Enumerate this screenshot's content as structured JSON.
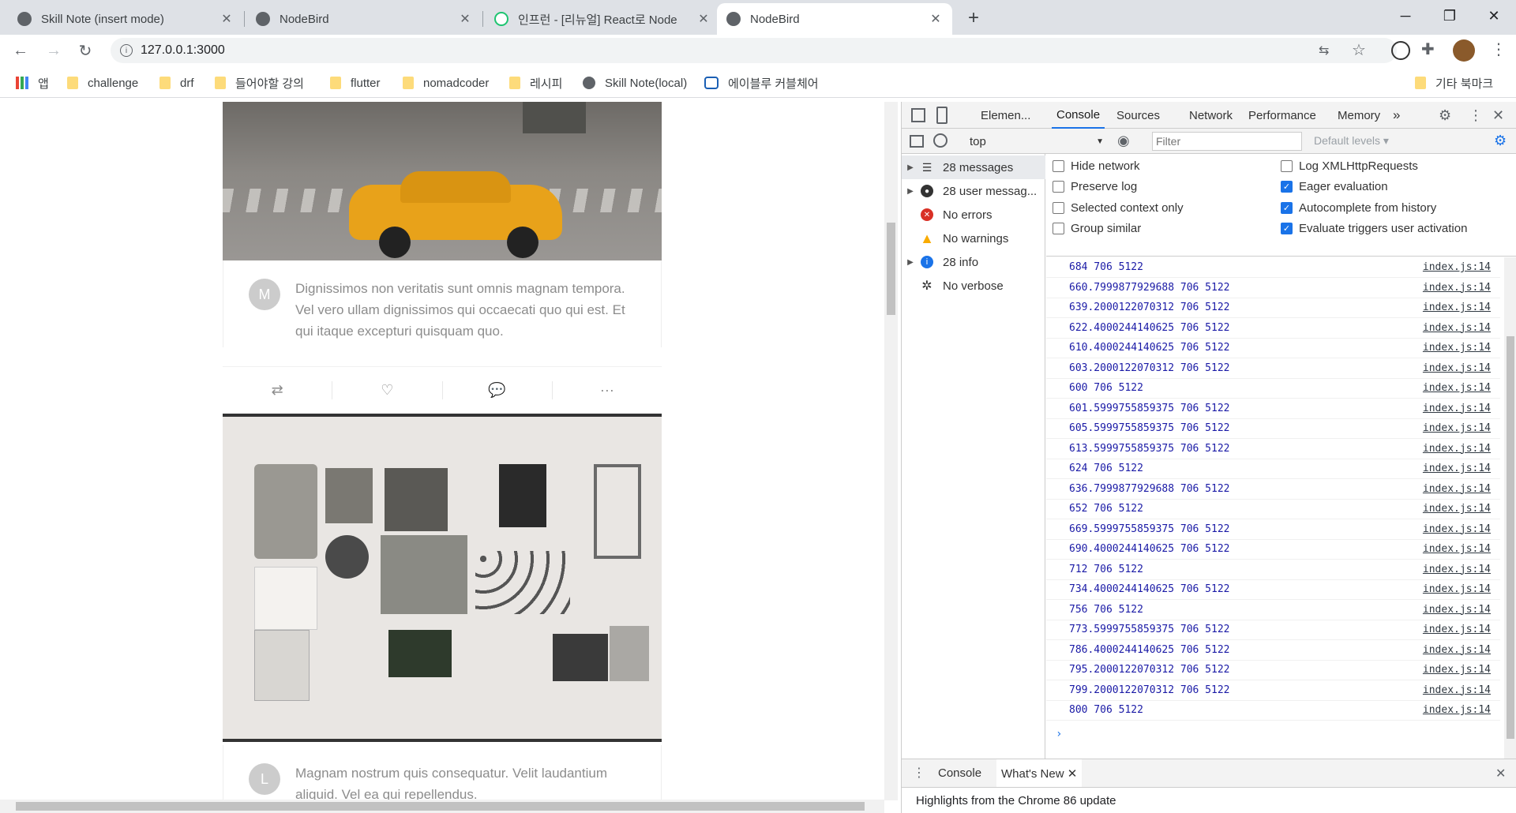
{
  "tabs": [
    {
      "title": "Skill Note (insert mode)",
      "active": false
    },
    {
      "title": "NodeBird",
      "active": false
    },
    {
      "title": "인프런 - [리뉴얼] React로 Node",
      "active": false
    },
    {
      "title": "NodeBird",
      "active": true
    }
  ],
  "address": {
    "url": "127.0.0.1:3000"
  },
  "bookmarks": [
    "앱",
    "challenge",
    "drf",
    "들어야할 강의",
    "flutter",
    "nomadcoder",
    "레시피",
    "Skill Note(local)",
    "에이블루 커블체어"
  ],
  "other_bookmarks": "기타 북마크",
  "posts": [
    {
      "avatar_letter": "M",
      "text": "Dignissimos non veritatis sunt omnis magnam tempora. Vel vero ullam dignissimos qui occaecati quo qui est. Et qui itaque excepturi quisquam quo."
    },
    {
      "avatar_letter": "L",
      "text": "Magnam nostrum quis consequatur. Velit laudantium aliquid. Vel ea qui repellendus."
    }
  ],
  "devtools": {
    "tabs": [
      "Elemen...",
      "Console",
      "Sources",
      "Network",
      "Performance",
      "Memory"
    ],
    "active_tab": "Console",
    "context": "top",
    "filter_placeholder": "Filter",
    "levels": "Default levels",
    "sidebar": [
      {
        "label": "28 messages",
        "icon": "list-icon",
        "expandable": true
      },
      {
        "label": "28 user messag...",
        "icon": "user-icon",
        "expandable": true
      },
      {
        "label": "No errors",
        "icon": "error-icon",
        "expandable": false
      },
      {
        "label": "No warnings",
        "icon": "warning-icon",
        "expandable": false
      },
      {
        "label": "28 info",
        "icon": "info-icon",
        "expandable": true
      },
      {
        "label": "No verbose",
        "icon": "bug-icon",
        "expandable": false
      }
    ],
    "settings": {
      "hide_network": {
        "label": "Hide network",
        "checked": false
      },
      "preserve_log": {
        "label": "Preserve log",
        "checked": false
      },
      "selected_context": {
        "label": "Selected context only",
        "checked": false
      },
      "group_similar": {
        "label": "Group similar",
        "checked": false
      },
      "log_xhr": {
        "label": "Log XMLHttpRequests",
        "checked": false
      },
      "eager_eval": {
        "label": "Eager evaluation",
        "checked": true
      },
      "autocomplete": {
        "label": "Autocomplete from history",
        "checked": true
      },
      "eval_triggers": {
        "label": "Evaluate triggers user activation",
        "checked": true
      }
    },
    "logs": [
      "684 706 5122",
      "660.7999877929688 706 5122",
      "639.2000122070312 706 5122",
      "622.4000244140625 706 5122",
      "610.4000244140625 706 5122",
      "603.2000122070312 706 5122",
      "600 706 5122",
      "601.5999755859375 706 5122",
      "605.5999755859375 706 5122",
      "613.5999755859375 706 5122",
      "624 706 5122",
      "636.7999877929688 706 5122",
      "652 706 5122",
      "669.5999755859375 706 5122",
      "690.4000244140625 706 5122",
      "712 706 5122",
      "734.4000244140625 706 5122",
      "756 706 5122",
      "773.5999755859375 706 5122",
      "786.4000244140625 706 5122",
      "795.2000122070312 706 5122",
      "799.2000122070312 706 5122",
      "800 706 5122"
    ],
    "log_source": "index.js:14",
    "drawer_tabs": [
      "Console",
      "What's New"
    ],
    "drawer_text": "Highlights from the Chrome 86 update"
  },
  "colors": {
    "accent": "#1a73e8",
    "log_text": "#1a1aa6",
    "error": "#d93025",
    "warning": "#f9ab00",
    "info": "#1a73e8"
  }
}
